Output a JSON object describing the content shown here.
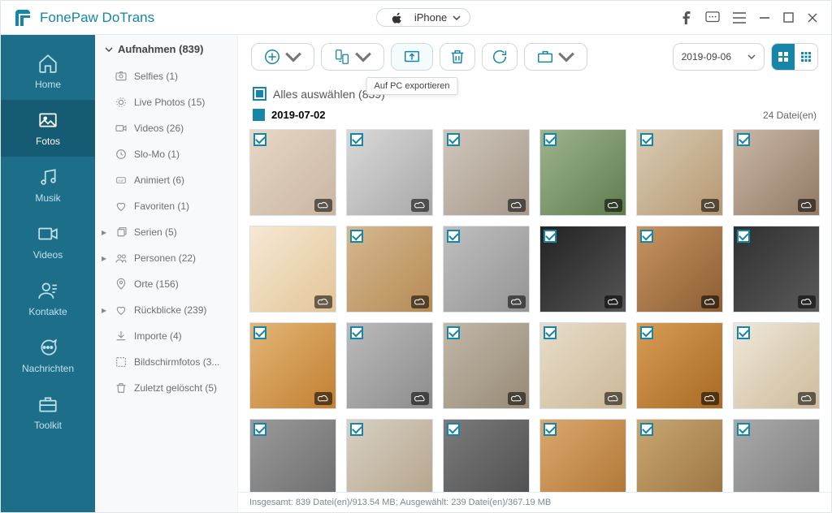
{
  "app": {
    "title": "FonePaw DoTrans"
  },
  "device": {
    "name": "iPhone"
  },
  "tooltip_export": "Auf PC exportieren",
  "sidebar": {
    "items": [
      {
        "label": "Home"
      },
      {
        "label": "Fotos"
      },
      {
        "label": "Musik"
      },
      {
        "label": "Videos"
      },
      {
        "label": "Kontakte"
      },
      {
        "label": "Nachrichten"
      },
      {
        "label": "Toolkit"
      }
    ]
  },
  "categories": {
    "header_label": "Aufnahmen (839)",
    "items": [
      {
        "label": "Selfies (1)"
      },
      {
        "label": "Live Photos (15)"
      },
      {
        "label": "Videos (26)"
      },
      {
        "label": "Slo-Mo (1)"
      },
      {
        "label": "Animiert (6)"
      },
      {
        "label": "Favoriten (1)"
      },
      {
        "label": "Serien (5)",
        "expandable": true
      },
      {
        "label": "Personen (22)",
        "expandable": true
      },
      {
        "label": "Orte (156)"
      },
      {
        "label": "Rückblicke (239)",
        "expandable": true
      },
      {
        "label": "Importe (4)"
      },
      {
        "label": "Bildschirmfotos (3..."
      },
      {
        "label": "Zuletzt gelöscht (5)"
      }
    ]
  },
  "toolbar": {
    "date_filter": "2019-09-06"
  },
  "select_all": {
    "label": "Alles auswählen (839)"
  },
  "group": {
    "date": "2019-07-02",
    "count_label": "24 Datei(en)"
  },
  "status": "Insgesamt: 839 Datei(en)/913.54 MB; Ausgewählt: 239 Datei(en)/367.19 MB",
  "thumbs": [
    {
      "c": true,
      "cl": true
    },
    {
      "c": true,
      "cl": true
    },
    {
      "c": true,
      "cl": true
    },
    {
      "c": true,
      "cl": true
    },
    {
      "c": true,
      "cl": true
    },
    {
      "c": true,
      "cl": true
    },
    {
      "c": false,
      "cl": true
    },
    {
      "c": true,
      "cl": true
    },
    {
      "c": true,
      "cl": true
    },
    {
      "c": true,
      "cl": true
    },
    {
      "c": true,
      "cl": true
    },
    {
      "c": true,
      "cl": true
    },
    {
      "c": true,
      "cl": true
    },
    {
      "c": true,
      "cl": true
    },
    {
      "c": true,
      "cl": true
    },
    {
      "c": true,
      "cl": true
    },
    {
      "c": true,
      "cl": true
    },
    {
      "c": true,
      "cl": true
    },
    {
      "c": true,
      "cl": false
    },
    {
      "c": true,
      "cl": false
    },
    {
      "c": true,
      "cl": false
    },
    {
      "c": true,
      "cl": false
    },
    {
      "c": true,
      "cl": false
    },
    {
      "c": true,
      "cl": false
    }
  ]
}
